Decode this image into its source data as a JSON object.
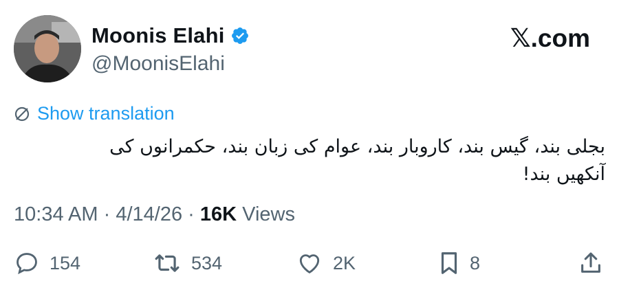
{
  "author": {
    "name": "Moonis Elahi",
    "handle": "@MoonisElahi"
  },
  "brand": "𝕏.com",
  "translate": {
    "label": "Show translation"
  },
  "tweet": {
    "text": "بجلی بند، گیس بند، کاروبار بند، عوام کی زبان بند، حکمرانوں کی آنکھیں بند!"
  },
  "meta": {
    "time": "10:34 AM",
    "date": "4/14/26",
    "sep1": "·",
    "sep2": "·",
    "views_count": "16K",
    "views_label": "Views"
  },
  "actions": {
    "replies": "154",
    "reposts": "534",
    "likes": "2K",
    "bookmarks": "8"
  },
  "colors": {
    "accent": "#1d9bf0",
    "secondary_text": "#536471",
    "primary_text": "#0f1419"
  },
  "icons": [
    "verified-badge-icon",
    "translate-icon",
    "reply-icon",
    "repost-icon",
    "like-icon",
    "bookmark-icon",
    "share-icon"
  ]
}
